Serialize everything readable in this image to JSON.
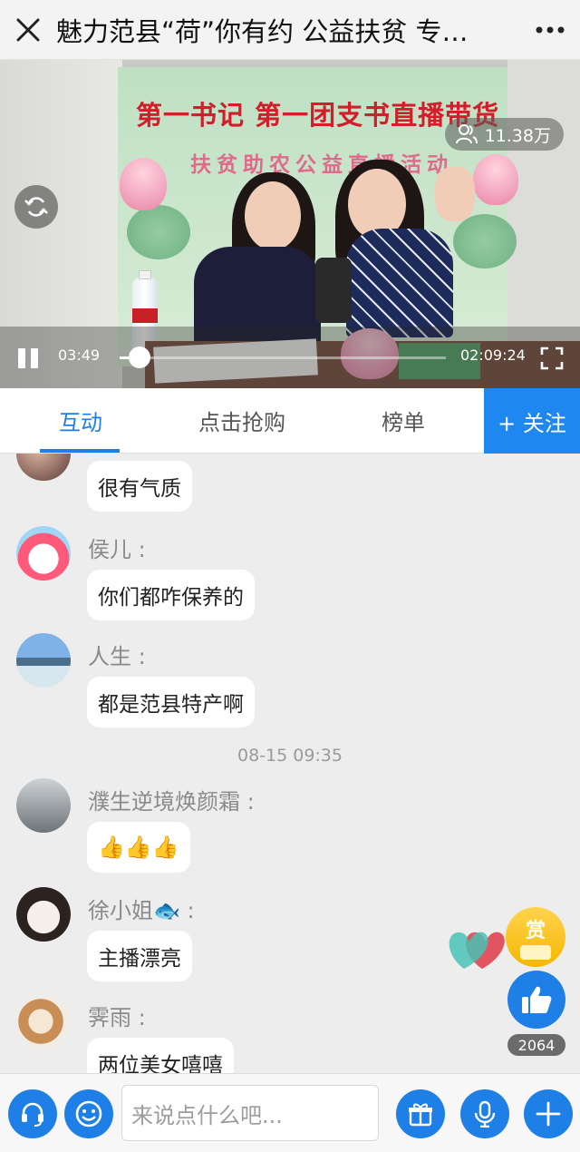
{
  "header": {
    "title": "魅力范县“荷”你有约 公益扶贫 专…"
  },
  "video": {
    "banner_line1": "第一书记  第一团支书直播带货",
    "banner_line2": "扶贫助农公益直播活动",
    "viewers": "11.38万",
    "current_time": "03:49",
    "total_time": "02:09:24",
    "progress": 0.03
  },
  "tabs": {
    "items": [
      {
        "label": "互动",
        "active": true
      },
      {
        "label": "点击抢购",
        "active": false
      },
      {
        "label": "榜单",
        "active": false
      }
    ],
    "follow_label": "+ 关注"
  },
  "chat": {
    "messages": [
      {
        "user": "",
        "text": "很有气质"
      },
      {
        "user": "侯儿 :",
        "text": "你们都咋保养的"
      },
      {
        "user": "人生 :",
        "text": "都是范县特产啊"
      },
      {
        "user": "濮生逆境焕颜霜 :",
        "text": "👍👍👍"
      },
      {
        "user": "徐小姐",
        "user_suffix": "🐟",
        "user_colon": " :",
        "text": "主播漂亮"
      },
      {
        "user": "霁雨 :",
        "text": "两位美女嘻嘻"
      }
    ],
    "timestamp": "08-15 09:35"
  },
  "actions": {
    "reward_label": "赏",
    "like_count": "2064"
  },
  "input": {
    "placeholder": "来说点什么吧..."
  },
  "colors": {
    "accent": "#1e7fe6",
    "reward": "#f5b700"
  }
}
